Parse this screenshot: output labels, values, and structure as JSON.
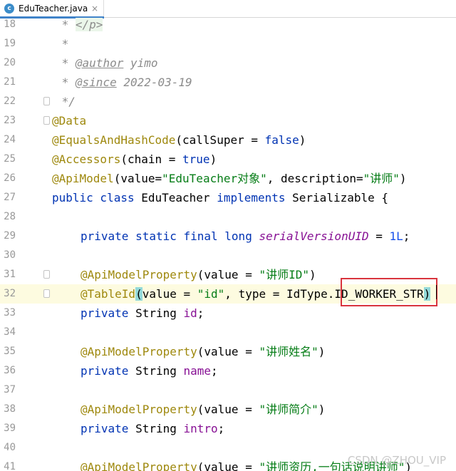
{
  "tab": {
    "label": "EduTeacher.java",
    "icon_letter": "c",
    "close": "×"
  },
  "lines": [
    {
      "n": "18"
    },
    {
      "n": "19"
    },
    {
      "n": "20"
    },
    {
      "n": "21"
    },
    {
      "n": "22"
    },
    {
      "n": "23"
    },
    {
      "n": "24"
    },
    {
      "n": "25"
    },
    {
      "n": "26"
    },
    {
      "n": "27"
    },
    {
      "n": "28"
    },
    {
      "n": "29"
    },
    {
      "n": "30"
    },
    {
      "n": "31"
    },
    {
      "n": "32"
    },
    {
      "n": "33"
    },
    {
      "n": "34"
    },
    {
      "n": "35"
    },
    {
      "n": "36"
    },
    {
      "n": "37"
    },
    {
      "n": "38"
    },
    {
      "n": "39"
    },
    {
      "n": "40"
    },
    {
      "n": "41"
    }
  ],
  "code": {
    "l18": {
      "a": " * ",
      "b": "</p>"
    },
    "l19": {
      "a": " *"
    },
    "l20": {
      "a": " * ",
      "tag": "@author",
      "b": " yimo"
    },
    "l21": {
      "a": " * ",
      "tag": "@since",
      "b": " 2022-03-19"
    },
    "l22": {
      "a": " */"
    },
    "l23": {
      "ann": "@Data"
    },
    "l24": {
      "ann": "@EqualsAndHashCode",
      "a": "(callSuper = ",
      "kw": "false",
      "b": ")"
    },
    "l25": {
      "ann": "@Accessors",
      "a": "(chain = ",
      "kw": "true",
      "b": ")"
    },
    "l26": {
      "ann": "@ApiModel",
      "a": "(value=",
      "s1": "\"EduTeacher对象\"",
      "b": ", description=",
      "s2": "\"讲师\"",
      "c": ")"
    },
    "l27": {
      "kw1": "public class",
      "a": " EduTeacher ",
      "kw2": "implements",
      "b": " Serializable {"
    },
    "l29": {
      "kw": "private static final long",
      "sp": " ",
      "field": "serialVersionUID",
      "a": " = ",
      "num": "1L",
      "b": ";"
    },
    "l31": {
      "ann": "@ApiModelProperty",
      "a": "(value = ",
      "s": "\"讲师ID\"",
      "b": ")"
    },
    "l32": {
      "ann": "@TableId",
      "p1": "(",
      "a": "value = ",
      "s": "\"id\"",
      "b": ", type = IdType.",
      "c": "ID_WORKER_STR",
      "p2": ")"
    },
    "l33": {
      "kw": "private",
      "a": " String ",
      "f": "id",
      "b": ";"
    },
    "l35": {
      "ann": "@ApiModelProperty",
      "a": "(value = ",
      "s": "\"讲师姓名\"",
      "b": ")"
    },
    "l36": {
      "kw": "private",
      "a": " String ",
      "f": "name",
      "b": ";"
    },
    "l38": {
      "ann": "@ApiModelProperty",
      "a": "(value = ",
      "s": "\"讲师简介\"",
      "b": ")"
    },
    "l39": {
      "kw": "private",
      "a": " String ",
      "f": "intro",
      "b": ";"
    },
    "l41": {
      "ann": "@ApiModelProperty",
      "a": "(value = ",
      "s": "\"讲师资历,一句话说明讲师\"",
      "b": ")"
    }
  },
  "watermark": "CSDN @ZHOU_VIP",
  "colors": {
    "keyword": "#0033b3",
    "annotation": "#9e880d",
    "string": "#067d17",
    "number": "#1750eb",
    "comment": "#8c8c8c",
    "static_field": "#871094",
    "highlight_box": "#d9343d",
    "current_line": "#fdfbe0"
  }
}
